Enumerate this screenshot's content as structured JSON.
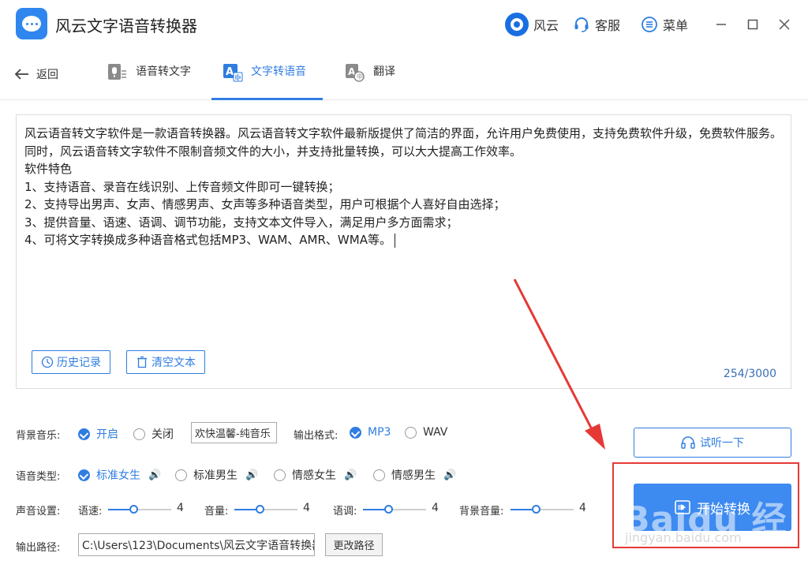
{
  "app": {
    "title": "风云文字语音转换器"
  },
  "titlebar": {
    "user_label": "风云",
    "service_label": "客服",
    "menu_label": "菜单"
  },
  "nav": {
    "back_label": "返回",
    "tabs": [
      {
        "label": "语音转文字"
      },
      {
        "label": "文字转语音"
      },
      {
        "label": "翻译"
      }
    ]
  },
  "editor": {
    "lines": [
      "风云语音转文字软件是一款语音转换器。风云语音转文字软件最新版提供了简洁的界面，允许用户免费使用，支持免费软件升级，免费软件服务。同时，风云语音转文字软件不限制音频文件的大小，并支持批量转换，可以大大提高工作效率。",
      "软件特色",
      "1、支持语音、录音在线识别、上传音频文件即可一键转换；",
      "2、支持导出男声、女声、情感男声、女声等多种语音类型，用户可根据个人喜好自由选择；",
      "3、提供音量、语速、语调、调节功能，支持文本文件导入，满足用户多方面需求；",
      "4、可将文字转换成多种语音格式包括MP3、WAM、AMR、WMA等。"
    ],
    "history_button": "历史记录",
    "clear_button": "清空文本",
    "counter": "254/3000"
  },
  "settings": {
    "bg_music_label": "背景音乐:",
    "bg_music_on": "开启",
    "bg_music_off": "关闭",
    "bg_music_track": "欢快温馨-纯音乐",
    "format_label": "输出格式:",
    "format_mp3": "MP3",
    "format_wav": "WAV",
    "voice_type_label": "语音类型:",
    "voice_types": [
      "标准女生",
      "标准男生",
      "情感女生",
      "情感男生"
    ],
    "sound_label": "声音设置:",
    "speed_label": "语速:",
    "speed_value": "4",
    "volume_label": "音量:",
    "volume_value": "4",
    "pitch_label": "语调:",
    "pitch_value": "4",
    "bg_volume_label": "背景音量:",
    "bg_volume_value": "4",
    "slider_level": 0.4,
    "output_label": "输出路径:",
    "output_path": "C:\\Users\\123\\Documents\\风云文字语音转换器",
    "change_path_button": "更改路径"
  },
  "actions": {
    "listen_button": "试听一下",
    "start_button": "开始转换"
  },
  "watermark": {
    "main": "Baidu 经验",
    "sub": "jingyan.baidu.com"
  },
  "colors": {
    "accent": "#2f7de1",
    "highlight": "#e53935"
  }
}
